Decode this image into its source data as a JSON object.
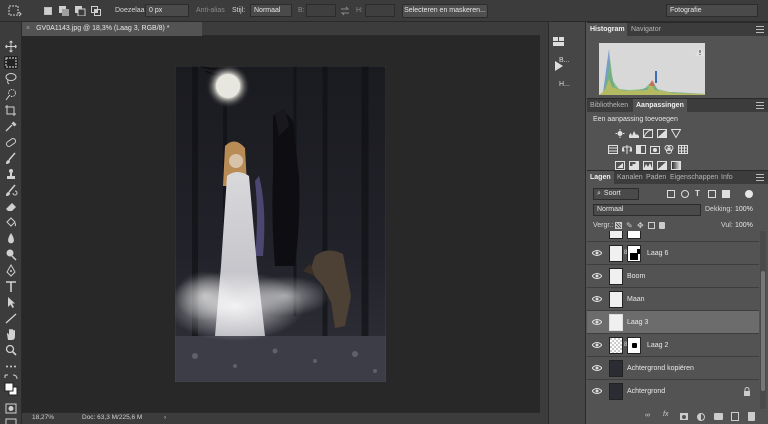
{
  "options_bar": {
    "feather_label": "Doezelaar:",
    "feather_value": "0 px",
    "antialias_label": "Anti-alias",
    "style_label": "Stijl:",
    "style_value": "Normaal",
    "width_label": "B:",
    "height_label": "H:",
    "select_mask_button": "Selecteren en maskeren...",
    "workspace_value": "Fotografie"
  },
  "document": {
    "tab_title": "GV0A1143.jpg @ 18,3% (Laag 3, RGB/8) *",
    "close_symbol": "×",
    "zoom_status": "18,27%",
    "doc_info": "Doc: 63,3 M/225,6 M",
    "status_arrow": "›"
  },
  "mini_panel": {
    "items": [
      {
        "label": "B...",
        "icon": "brush-settings-icon"
      },
      {
        "label": "H...",
        "icon": "play-icon"
      }
    ]
  },
  "histogram_panel": {
    "tabs": [
      {
        "label": "Histogram",
        "active": true
      },
      {
        "label": "Navigator",
        "active": false
      }
    ]
  },
  "adjustments_panel": {
    "tabs": [
      {
        "label": "Bibliotheken",
        "active": false
      },
      {
        "label": "Aanpassingen",
        "active": true
      }
    ],
    "add_adjustment_label": "Een aanpassing toevoegen"
  },
  "layers_panel": {
    "tabs": [
      {
        "label": "Lagen",
        "active": true
      },
      {
        "label": "Kanalen",
        "active": false
      },
      {
        "label": "Paden",
        "active": false
      },
      {
        "label": "Eigenschappen",
        "active": false
      },
      {
        "label": "Info",
        "active": false
      }
    ],
    "filter_value": "Soort",
    "blend_mode": "Normaal",
    "opacity_label": "Dekking:",
    "opacity_value": "100%",
    "lock_label": "Vergr.:",
    "fill_label": "Vul:",
    "fill_value": "100%",
    "layers": [
      {
        "name": "Laag 6",
        "has_mask": true,
        "selected": false
      },
      {
        "name": "Boom",
        "has_mask": false,
        "selected": false
      },
      {
        "name": "Maan",
        "has_mask": false,
        "selected": false
      },
      {
        "name": "Laag 3",
        "has_mask": false,
        "selected": true
      },
      {
        "name": "Laag 2",
        "has_mask": true,
        "selected": false
      },
      {
        "name": "Achtergrond kopiëren",
        "has_mask": false,
        "selected": false
      },
      {
        "name": "Achtergrond",
        "has_mask": false,
        "selected": false,
        "locked": true
      }
    ]
  },
  "colors": {
    "app_dark": "#3c3c3c",
    "panel": "#535353",
    "workspace": "#282828",
    "selected_layer": "#6c6c6c"
  }
}
